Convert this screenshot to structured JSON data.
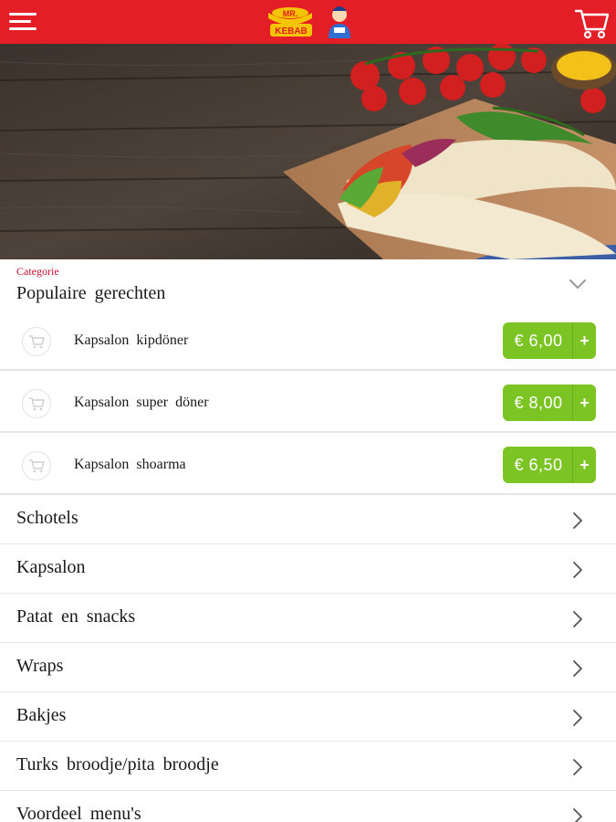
{
  "header": {
    "logo_text_top": "MR.",
    "logo_text_bottom": "KEBAB",
    "menu_icon": "hamburger-menu-icon",
    "cart_icon": "shopping-cart-icon",
    "brand_color": "#e41e26"
  },
  "category": {
    "label": "Categorie",
    "title": "Populaire gerechten",
    "toggle_icon": "chevron-down-icon"
  },
  "products": [
    {
      "name": "Kapsalon kipdöner",
      "price": "€ 6,00",
      "add": "+"
    },
    {
      "name": "Kapsalon super döner",
      "price": "€ 8,00",
      "add": "+"
    },
    {
      "name": "Kapsalon shoarma",
      "price": "€ 6,50",
      "add": "+"
    }
  ],
  "categories": [
    {
      "name": "Schotels"
    },
    {
      "name": "Kapsalon"
    },
    {
      "name": "Patat en snacks"
    },
    {
      "name": "Wraps"
    },
    {
      "name": "Bakjes"
    },
    {
      "name": "Turks broodje/pita broodje"
    },
    {
      "name": "Voordeel menu's"
    }
  ],
  "colors": {
    "accent_red": "#e41e26",
    "category_label_red": "#c8102e",
    "price_green": "#7bc423"
  }
}
